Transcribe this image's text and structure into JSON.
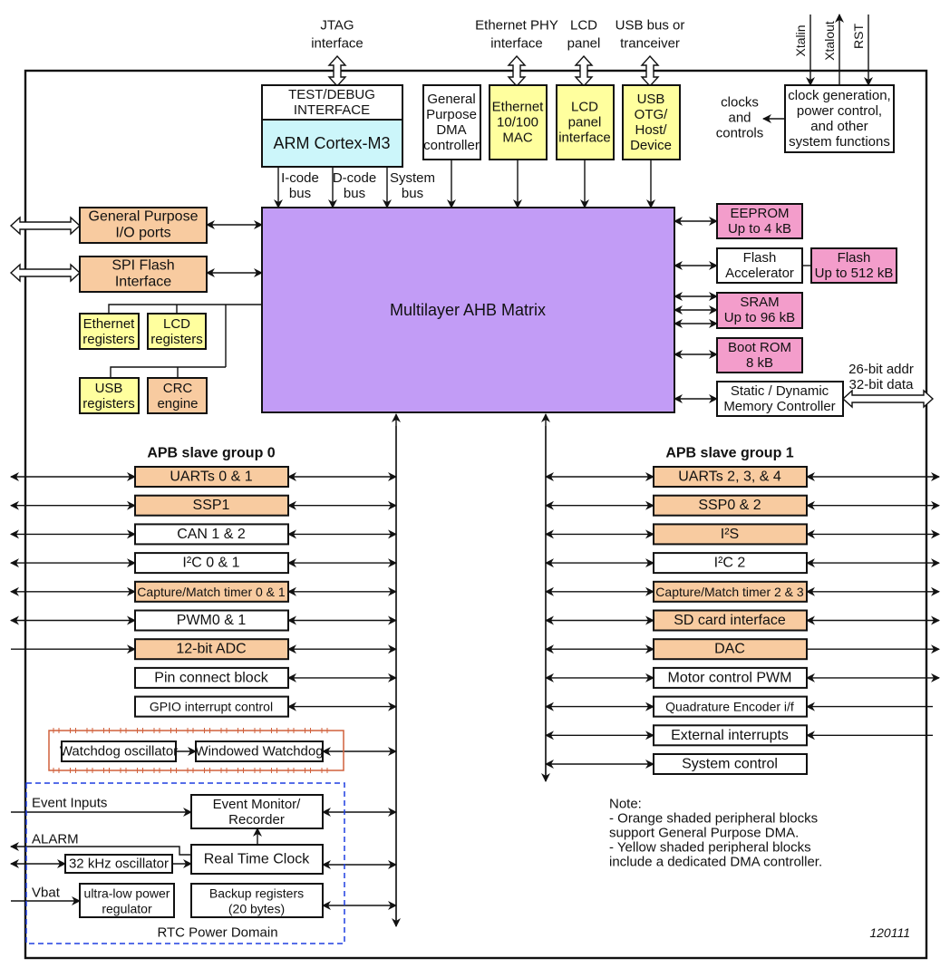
{
  "colors": {
    "orange": "#F8CBA0",
    "yellow": "#FFFF9E",
    "pink": "#F39DCB",
    "cyan": "#CCF6FA",
    "purple": "#C29CF6",
    "white": "#FFFFFF",
    "watchdog_border": "#D0603C",
    "rtc_border": "#1E3FE0"
  },
  "external": {
    "jtag": [
      "JTAG",
      "interface"
    ],
    "ethernet_phy": [
      "Ethernet PHY",
      "interface"
    ],
    "lcd_panel": [
      "LCD",
      "panel"
    ],
    "usb_bus": [
      "USB bus or",
      "tranceiver"
    ],
    "xtalin": "Xtalin",
    "xtalout": "Xtalout",
    "rst": "RST",
    "clocks_controls": [
      "clocks",
      "and",
      "controls"
    ],
    "addr_data": [
      "26-bit addr",
      "32-bit data"
    ]
  },
  "top_blocks": {
    "test_debug": [
      "TEST/DEBUG",
      "INTERFACE"
    ],
    "cortex": "ARM Cortex-M3",
    "buses": [
      [
        "I-code",
        "bus"
      ],
      [
        "D-code",
        "bus"
      ],
      [
        "System",
        "bus"
      ]
    ],
    "gp_dma": [
      "General",
      "Purpose",
      "DMA",
      "controller"
    ],
    "ethernet_mac": [
      "Ethernet",
      "10/100",
      "MAC"
    ],
    "lcd_interface": [
      "LCD",
      "panel",
      "interface"
    ],
    "usb": [
      "USB",
      "OTG/",
      "Host/",
      "Device"
    ],
    "clock_gen": [
      "clock generation,",
      "power control,",
      "and other",
      "system functions"
    ]
  },
  "ahb_matrix": "Multilayer AHB Matrix",
  "left_blocks": {
    "gpio": [
      "General Purpose",
      "I/O ports"
    ],
    "spifi": [
      "SPI Flash",
      "Interface"
    ],
    "eth_regs": [
      "Ethernet",
      "registers"
    ],
    "lcd_regs": [
      "LCD",
      "registers"
    ],
    "usb_regs": [
      "USB",
      "registers"
    ],
    "crc": [
      "CRC",
      "engine"
    ]
  },
  "memory_blocks": {
    "eeprom": [
      "EEPROM",
      "Up to 4 kB"
    ],
    "flash_accel": [
      "Flash",
      "Accelerator"
    ],
    "flash": [
      "Flash",
      "Up to 512 kB"
    ],
    "sram": [
      "SRAM",
      "Up to 96 kB"
    ],
    "boot_rom": [
      "Boot ROM",
      "8 kB"
    ],
    "emc": [
      "Static / Dynamic",
      "Memory Controller"
    ]
  },
  "apb0": {
    "title": "APB slave group 0",
    "items": [
      {
        "label": "UARTs 0 & 1",
        "color": "orange"
      },
      {
        "label": "SSP1",
        "color": "orange"
      },
      {
        "label": "CAN 1 & 2",
        "color": "white"
      },
      {
        "label": "I²C 0 & 1",
        "color": "white"
      },
      {
        "label": "Capture/Match timer 0 & 1",
        "color": "orange"
      },
      {
        "label": "PWM0 & 1",
        "color": "white"
      },
      {
        "label": "12-bit ADC",
        "color": "orange"
      },
      {
        "label": "Pin connect block",
        "color": "white"
      },
      {
        "label": "GPIO interrupt control",
        "color": "white"
      }
    ]
  },
  "apb1": {
    "title": "APB slave group 1",
    "items": [
      {
        "label": "UARTs 2, 3, & 4",
        "color": "orange"
      },
      {
        "label": "SSP0 & 2",
        "color": "orange"
      },
      {
        "label": "I²S",
        "color": "orange"
      },
      {
        "label": "I²C 2",
        "color": "white"
      },
      {
        "label": "Capture/Match timer 2 & 3",
        "color": "orange"
      },
      {
        "label": "SD card interface",
        "color": "orange"
      },
      {
        "label": "DAC",
        "color": "orange"
      },
      {
        "label": "Motor control PWM",
        "color": "white"
      },
      {
        "label": "Quadrature Encoder i/f",
        "color": "white"
      },
      {
        "label": "External interrupts",
        "color": "white"
      },
      {
        "label": "System control",
        "color": "white"
      }
    ]
  },
  "watchdog": {
    "oscillator": "Watchdog oscillator",
    "windowed": "Windowed Watchdog"
  },
  "rtc": {
    "domain_label": "RTC Power Domain",
    "event_inputs": "Event Inputs",
    "alarm": "ALARM",
    "vbat": "Vbat",
    "event_monitor": [
      "Event Monitor/",
      "Recorder"
    ],
    "rtc_block": "Real Time Clock",
    "osc32k": "32 kHz oscillator",
    "regulator": [
      "ultra-low power",
      "regulator"
    ],
    "backup": [
      "Backup registers",
      "(20 bytes)"
    ]
  },
  "note": [
    "Note:",
    "- Orange shaded peripheral blocks",
    "support General Purpose DMA.",
    "- Yellow shaded peripheral blocks",
    "include a dedicated DMA controller."
  ],
  "figure_id": "120111"
}
